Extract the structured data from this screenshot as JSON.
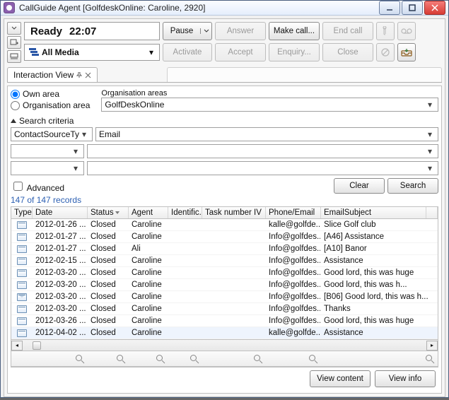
{
  "title": "CallGuide Agent [GolfdeskOnline: Caroline, 2920]",
  "ready": {
    "label": "Ready",
    "time": "22:07"
  },
  "toolbar1": {
    "pause": "Pause",
    "answer": "Answer",
    "makecall": "Make call...",
    "endcall": "End call"
  },
  "media": {
    "label": "All Media"
  },
  "toolbar2": {
    "activate": "Activate",
    "accept": "Accept",
    "enquiry": "Enquiry...",
    "close": "Close"
  },
  "tab": "Interaction View",
  "areas": {
    "own": "Own area",
    "org": "Organisation area",
    "label": "Organisation areas",
    "value": "GolfDeskOnline"
  },
  "criteria": {
    "label": "Search criteria",
    "source_field": "ContactSourceTy",
    "source_value": "Email",
    "advanced": "Advanced",
    "clear": "Clear",
    "search": "Search",
    "count": "147 of 147 records"
  },
  "columns": {
    "type": "Type",
    "date": "Date",
    "status": "Status",
    "agent": "Agent",
    "ident": "Identific...",
    "task": "Task number IV",
    "phone": "Phone/Email",
    "subj": "EmailSubject"
  },
  "rows": [
    {
      "icon": "card",
      "date": "2012-01-26 ...",
      "status": "Closed",
      "agent": "Caroline",
      "phone": "kalle@golfde...",
      "subj": "Slice Golf club"
    },
    {
      "icon": "card",
      "date": "2012-01-27 ...",
      "status": "Closed",
      "agent": "Caroline",
      "phone": "Info@golfdes...",
      "subj": "[A46] Assistance"
    },
    {
      "icon": "card",
      "date": "2012-01-27 ...",
      "status": "Closed",
      "agent": "Ali",
      "phone": "Info@golfdes...",
      "subj": "[A10] Banor"
    },
    {
      "icon": "card",
      "date": "2012-02-15 ...",
      "status": "Closed",
      "agent": "Caroline",
      "phone": "Info@golfdes...",
      "subj": "Assistance"
    },
    {
      "icon": "card",
      "date": "2012-03-20 ...",
      "status": "Closed",
      "agent": "Caroline",
      "phone": "Info@golfdes...",
      "subj": "Good lord, this was huge"
    },
    {
      "icon": "card",
      "date": "2012-03-20 ...",
      "status": "Closed",
      "agent": "Caroline",
      "phone": "Info@golfdes...",
      "subj": "Good lord, this was h..."
    },
    {
      "icon": "env",
      "date": "2012-03-20 ...",
      "status": "Closed",
      "agent": "Caroline",
      "phone": "Info@golfdes...",
      "subj": "[B06] Good lord, this was h..."
    },
    {
      "icon": "card",
      "date": "2012-03-20 ...",
      "status": "Closed",
      "agent": "Caroline",
      "phone": "Info@golfdes...",
      "subj": "Thanks"
    },
    {
      "icon": "card",
      "date": "2012-03-26 ...",
      "status": "Closed",
      "agent": "Caroline",
      "phone": "Info@golfdes...",
      "subj": "Good lord, this was huge"
    },
    {
      "icon": "card",
      "date": "2012-04-02 ...",
      "status": "Closed",
      "agent": "Caroline",
      "phone": "kalle@golfde...",
      "subj": "Assistance"
    }
  ],
  "footer": {
    "content": "View content",
    "info": "View info"
  }
}
